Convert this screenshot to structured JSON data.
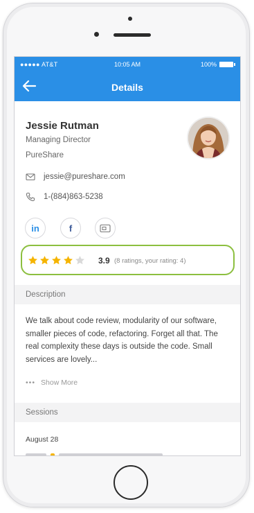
{
  "status_bar": {
    "carrier": "●●●●● AT&T",
    "time": "10:05 AM",
    "battery": "100%"
  },
  "nav": {
    "title": "Details",
    "back_icon": "arrow-left-icon"
  },
  "profile": {
    "name": "Jessie Rutman",
    "role": "Managing Director",
    "company": "PureShare",
    "email": "jessie@pureshare.com",
    "phone": "1-(884)863-5238"
  },
  "social": {
    "linkedin_label": "in",
    "facebook_label": "f"
  },
  "rating": {
    "stars_filled": 4,
    "stars_total": 5,
    "value": "3.9",
    "meta": "(8 ratings, your rating: 4)"
  },
  "sections": {
    "description_title": "Description",
    "description_text": "We talk about code review, modularity of our software, smaller pieces of code, refactoring. Forget all that. The real complexity these days is outside the code. Small services are lovely...",
    "show_more_dots": "•••",
    "show_more": "Show More",
    "sessions_title": "Sessions",
    "session_date": "August 28"
  },
  "colors": {
    "accent": "#2a8fe6",
    "rating_border": "#8cbf3f",
    "star": "#f5b400",
    "star_empty": "#d9d9d9"
  }
}
